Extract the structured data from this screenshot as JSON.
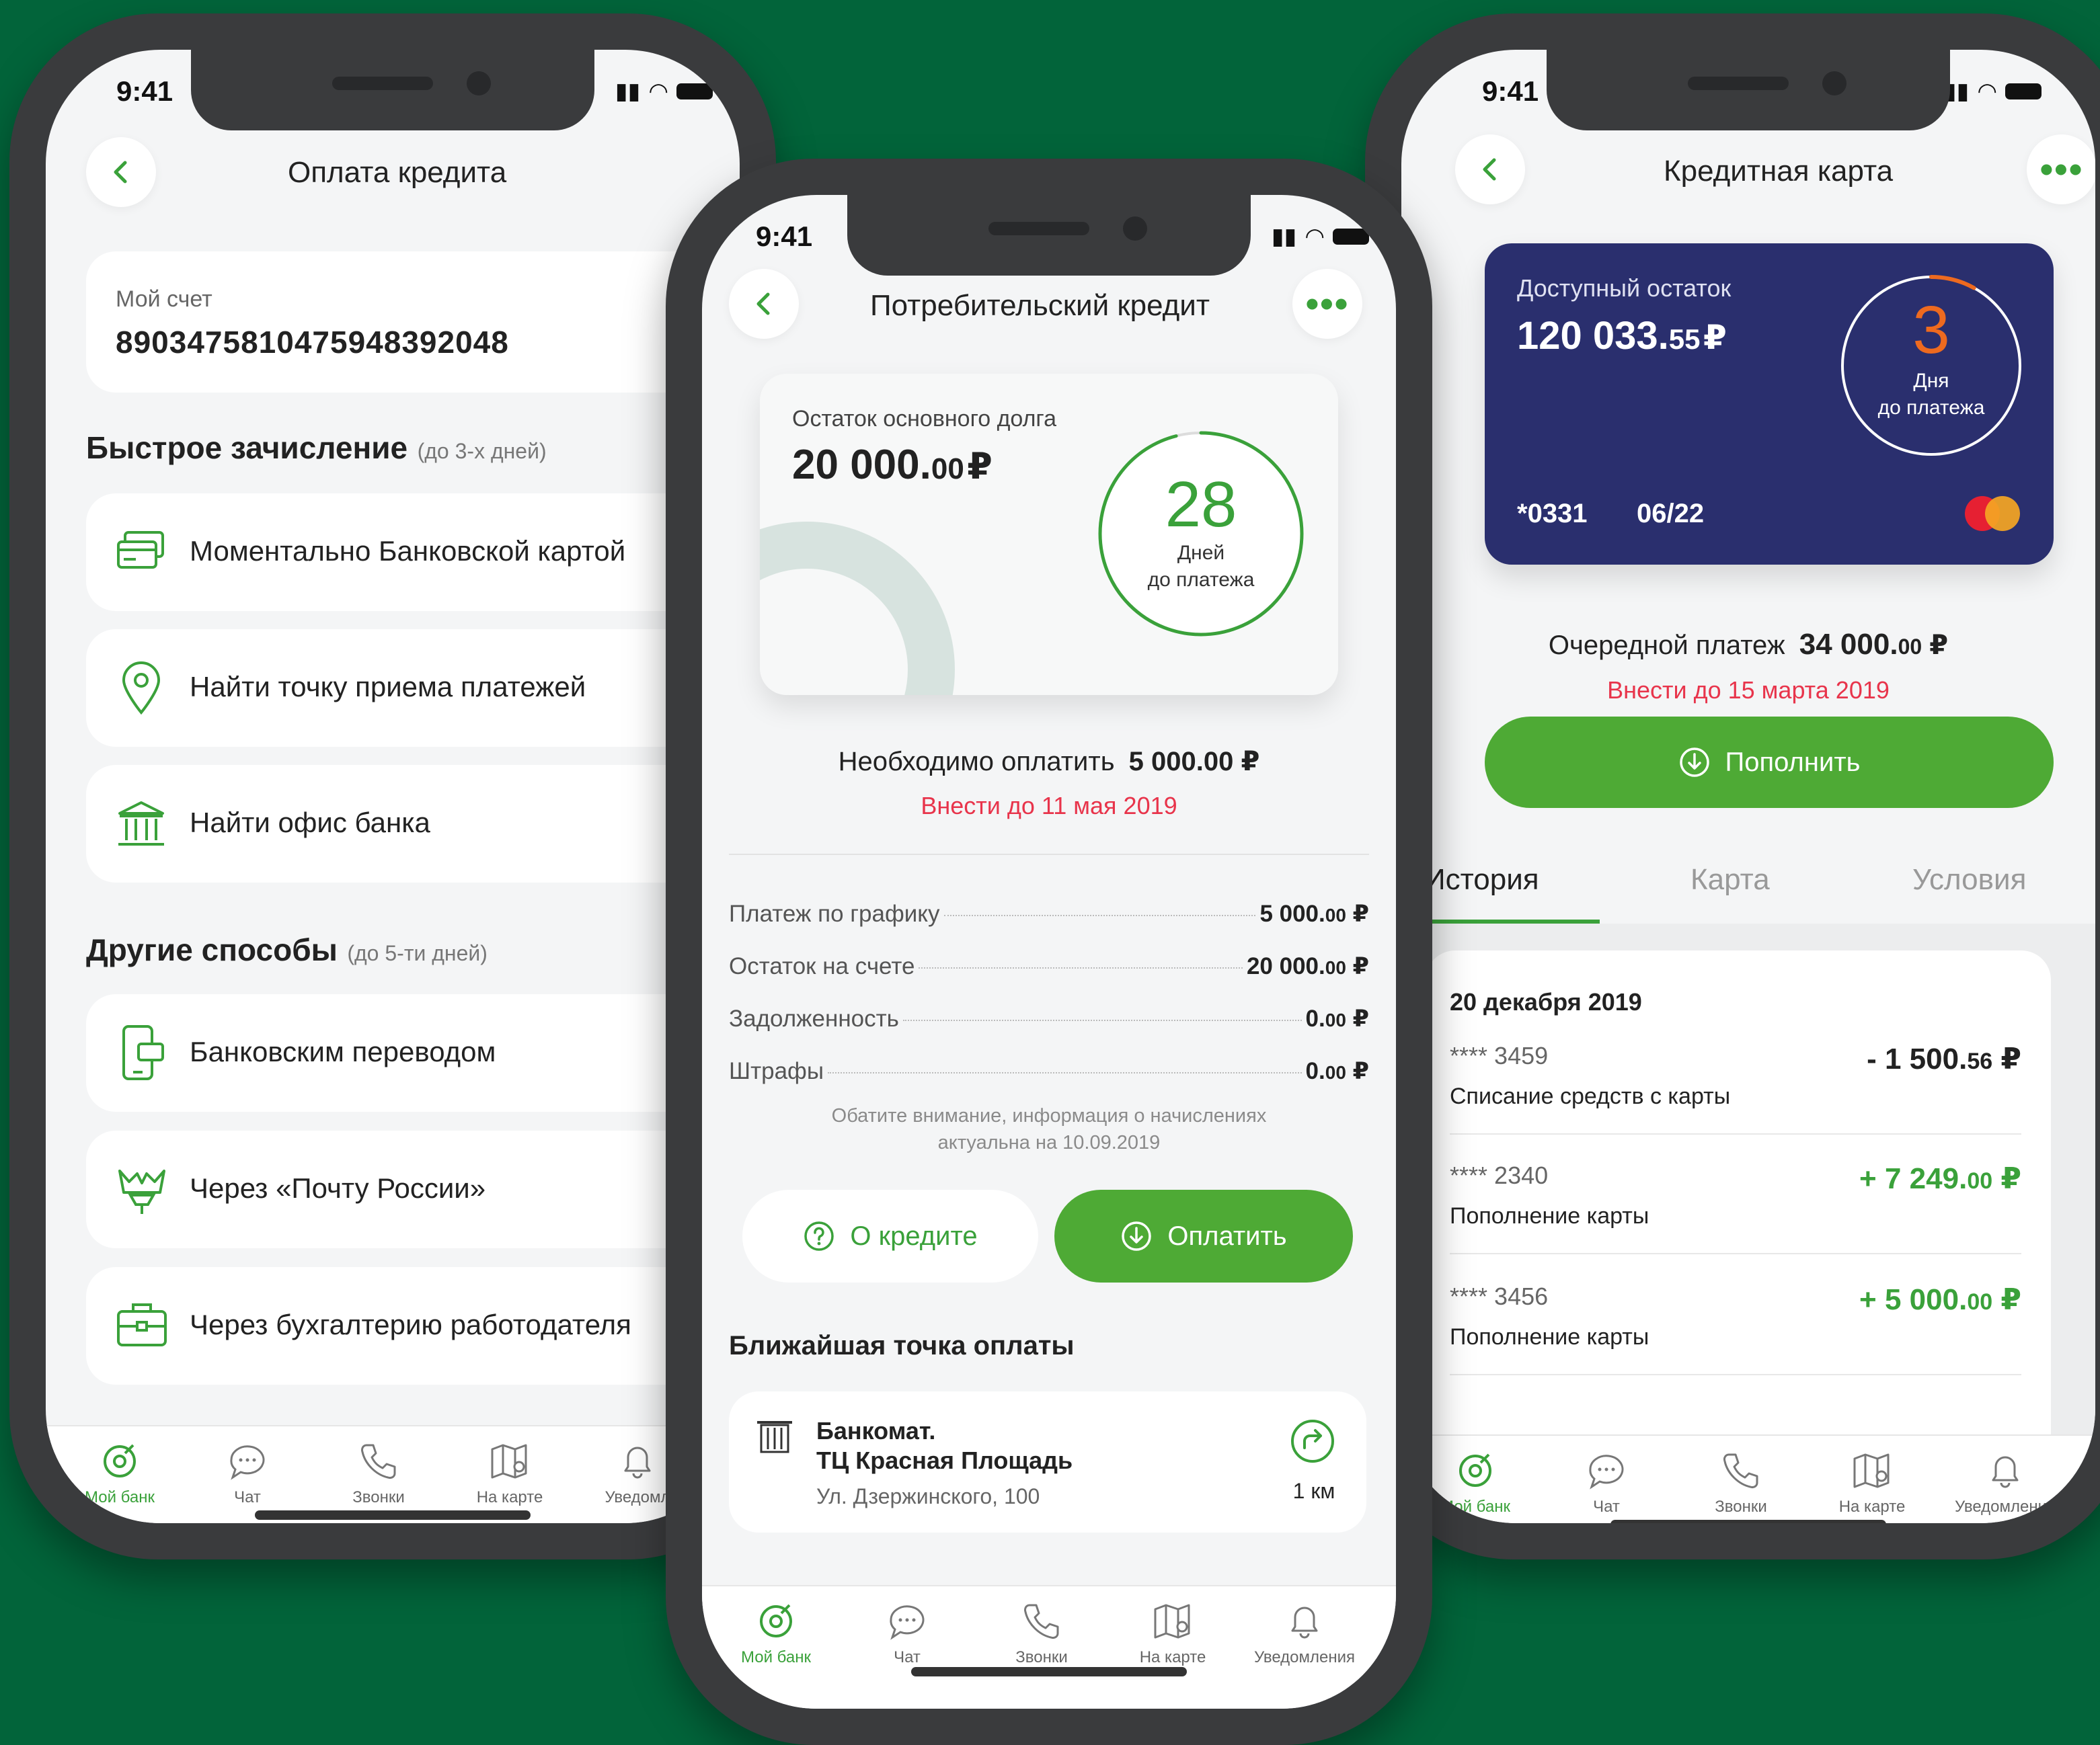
{
  "status": {
    "time": "9:41"
  },
  "colors": {
    "background": "#02643a",
    "accent_green": "#3aa13a",
    "button_green": "#4eaa35",
    "deadline_red": "#e8344b",
    "card_navy": "#2a2f6e",
    "timer_orange": "#ee6a1f"
  },
  "tabs": [
    "Мой банк",
    "Чат",
    "Звонки",
    "На карте",
    "Уведомления"
  ],
  "tab_icons": [
    "bank-icon",
    "chat-icon",
    "phone-icon",
    "map-icon",
    "bell-icon"
  ],
  "left": {
    "title": "Оплата кредита",
    "account_label": "Мой счет",
    "account_number": "89034758104759483920​48",
    "fast_heading": "Быстрое зачисление",
    "fast_note": "(до 3-х дней)",
    "fast_items": [
      {
        "label": "Моментально Банковской картой",
        "icon": "bank-card-icon"
      },
      {
        "label": "Найти точку приема платежей",
        "icon": "map-pin-icon"
      },
      {
        "label": "Найти офис банка",
        "icon": "bank-building-icon"
      }
    ],
    "other_heading": "Другие способы",
    "other_note": "(до 5-ти дней)",
    "other_items": [
      {
        "label": "Банковским переводом",
        "icon": "mobile-transfer-icon"
      },
      {
        "label": "Через «Почту России»",
        "icon": "post-emblem-icon"
      },
      {
        "label": "Через бухгалтерию работодателя",
        "icon": "briefcase-icon"
      }
    ],
    "tab_partial": "Уведомл"
  },
  "middle": {
    "title": "Потребительский кредит",
    "debt_label": "Остаток основного долга",
    "debt_int": "20 000.",
    "debt_dec": "00",
    "currency": "₽",
    "days": "28",
    "days_label": "Дней",
    "days_sub": "до платежа",
    "days_progress": 0.96,
    "must_pay_label": "Необходимо оплатить",
    "must_pay_amount": "5 000.00 ₽",
    "deadline": "Внести до 11 мая 2019",
    "rows": [
      {
        "label": "Платеж по графику",
        "int": "5 000.",
        "dec": "00",
        "cur": "₽"
      },
      {
        "label": "Остаток на счете",
        "int": "20 000.",
        "dec": "00",
        "cur": "₽"
      },
      {
        "label": "Задолженность",
        "int": "0.",
        "dec": "00",
        "cur": "₽"
      },
      {
        "label": "Штрафы",
        "int": "0.",
        "dec": "00",
        "cur": "₽"
      }
    ],
    "notice_1": "Обатите внимание, информация о начислениях",
    "notice_2": "актуальна на 10.09.2019",
    "about_button": "О кредите",
    "pay_button": "Оплатить",
    "nearest_heading": "Ближайшая точка оплаты",
    "atm_line1": "Банкомат.",
    "atm_line2": "ТЦ Красная Площадь",
    "atm_address": "Ул. Дзержинского, 100",
    "atm_distance": "1 км"
  },
  "right": {
    "title": "Кредитная карта",
    "available_label": "Доступный остаток",
    "available_int": "120 033.",
    "available_dec": "55",
    "currency": "₽",
    "days": "3",
    "days_label": "Дня",
    "days_sub": "до платежа",
    "days_progress": 0.08,
    "card_mask": "*0331",
    "card_exp": "06/22",
    "next_label": "Очередной платеж",
    "next_int": "34 000.",
    "next_dec": "00",
    "deadline": "Внести до 15 марта 2019",
    "topup_button": "Пополнить",
    "tabs": [
      "История",
      "Карта",
      "Условия"
    ],
    "history_date": "20 декабря 2019",
    "history": [
      {
        "mask": "**** 3459",
        "int": "- 1 500.",
        "dec": "56",
        "cur": "₽",
        "desc": "Списание средств с карты",
        "positive": false
      },
      {
        "mask": "**** 2340",
        "int": "+ 7 249.",
        "dec": "00",
        "cur": "₽",
        "desc": "Пополнение карты",
        "positive": true
      },
      {
        "mask": "**** 3456",
        "int": "+ 5 000.",
        "dec": "00",
        "cur": "₽",
        "desc": "Пополнение карты",
        "positive": true
      }
    ]
  }
}
